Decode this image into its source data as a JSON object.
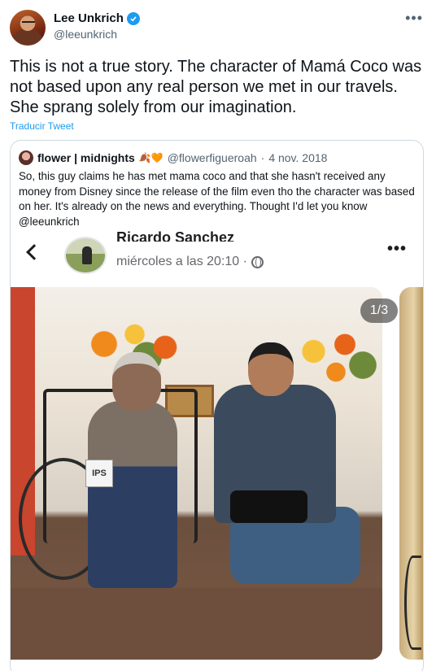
{
  "author": {
    "name": "Lee Unkrich",
    "handle": "@leeunkrich",
    "verified": true
  },
  "tweet": {
    "text": "This is not a true story. The character of Mamá Coco was not based upon any real person we met in our travels. She sprang solely from our imagination.",
    "translate_label": "Traducir Tweet"
  },
  "quoted": {
    "name": "flower | midnights",
    "emoji": "🍂🧡",
    "handle": "@flowerfigueroah",
    "separator": "·",
    "date": "4 nov. 2018",
    "text": "So, this guy claims he has met mama coco and that she hasn't received any money from Disney since the release of the film even tho the character was based on her. It's already on the news and everything. Thought I'd let you know @leeunkrich"
  },
  "media": {
    "fb_name": "Ricardo Sanchez",
    "fb_time": "miércoles a las 20:10 ·",
    "photo_counter": "1/3",
    "chair_label": "IPS"
  },
  "icons": [
    "verified-icon",
    "more-icon",
    "back-arrow-icon",
    "globe-icon",
    "more-dots-icon"
  ],
  "colors": {
    "link": "#1d9bf0",
    "muted": "#536471",
    "border": "#cfd9de"
  }
}
